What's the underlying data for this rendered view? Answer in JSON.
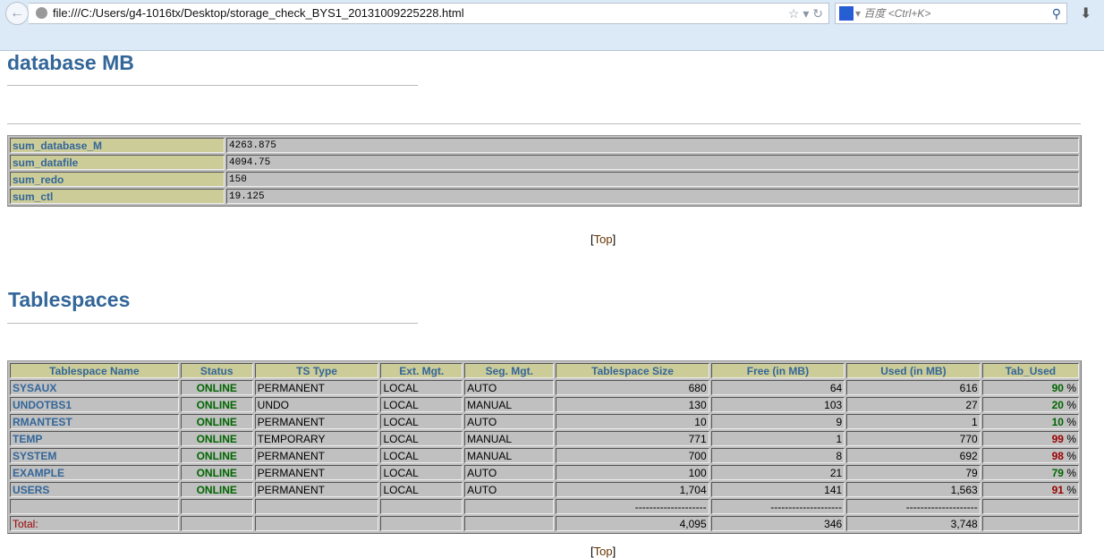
{
  "browser": {
    "url": "file:///C:/Users/g4-1016tx/Desktop/storage_check_BYS1_20131009225228.html",
    "search_placeholder": "百度 <Ctrl+K>"
  },
  "section1": {
    "title": "database MB",
    "rows": [
      {
        "label": "sum_database_M",
        "value": "4263.875"
      },
      {
        "label": "sum_datafile",
        "value": "4094.75"
      },
      {
        "label": "sum_redo",
        "value": "150"
      },
      {
        "label": "sum_ctl",
        "value": "19.125"
      }
    ]
  },
  "top_link": {
    "open": "[",
    "label": "Top",
    "close": "]"
  },
  "section2": {
    "title": "Tablespaces",
    "headers": [
      "Tablespace Name",
      "Status",
      "TS Type",
      "Ext. Mgt.",
      "Seg. Mgt.",
      "Tablespace Size",
      "Free (in MB)",
      "Used (in MB)",
      "Tab_Used"
    ],
    "rows": [
      {
        "name": "SYSAUX",
        "status": "ONLINE",
        "type": "PERMANENT",
        "ext": "LOCAL",
        "seg": "AUTO",
        "size": "680",
        "free": "64",
        "used": "616",
        "pct": "90",
        "level": "ok"
      },
      {
        "name": "UNDOTBS1",
        "status": "ONLINE",
        "type": "UNDO",
        "ext": "LOCAL",
        "seg": "MANUAL",
        "size": "130",
        "free": "103",
        "used": "27",
        "pct": "20",
        "level": "ok"
      },
      {
        "name": "RMANTEST",
        "status": "ONLINE",
        "type": "PERMANENT",
        "ext": "LOCAL",
        "seg": "AUTO",
        "size": "10",
        "free": "9",
        "used": "1",
        "pct": "10",
        "level": "ok"
      },
      {
        "name": "TEMP",
        "status": "ONLINE",
        "type": "TEMPORARY",
        "ext": "LOCAL",
        "seg": "MANUAL",
        "size": "771",
        "free": "1",
        "used": "770",
        "pct": "99",
        "level": "high"
      },
      {
        "name": "SYSTEM",
        "status": "ONLINE",
        "type": "PERMANENT",
        "ext": "LOCAL",
        "seg": "MANUAL",
        "size": "700",
        "free": "8",
        "used": "692",
        "pct": "98",
        "level": "high"
      },
      {
        "name": "EXAMPLE",
        "status": "ONLINE",
        "type": "PERMANENT",
        "ext": "LOCAL",
        "seg": "AUTO",
        "size": "100",
        "free": "21",
        "used": "79",
        "pct": "79",
        "level": "ok"
      },
      {
        "name": "USERS",
        "status": "ONLINE",
        "type": "PERMANENT",
        "ext": "LOCAL",
        "seg": "AUTO",
        "size": "1,704",
        "free": "141",
        "used": "1,563",
        "pct": "91",
        "level": "high"
      }
    ],
    "separator": "--------------------",
    "percent_sign": "%",
    "total": {
      "label": "Total:",
      "size": "4,095",
      "free": "346",
      "used": "3,748"
    }
  },
  "colors": {
    "heading": "#336699",
    "header_bg": "#cccc99",
    "ok": "#006600",
    "high": "#990000"
  }
}
